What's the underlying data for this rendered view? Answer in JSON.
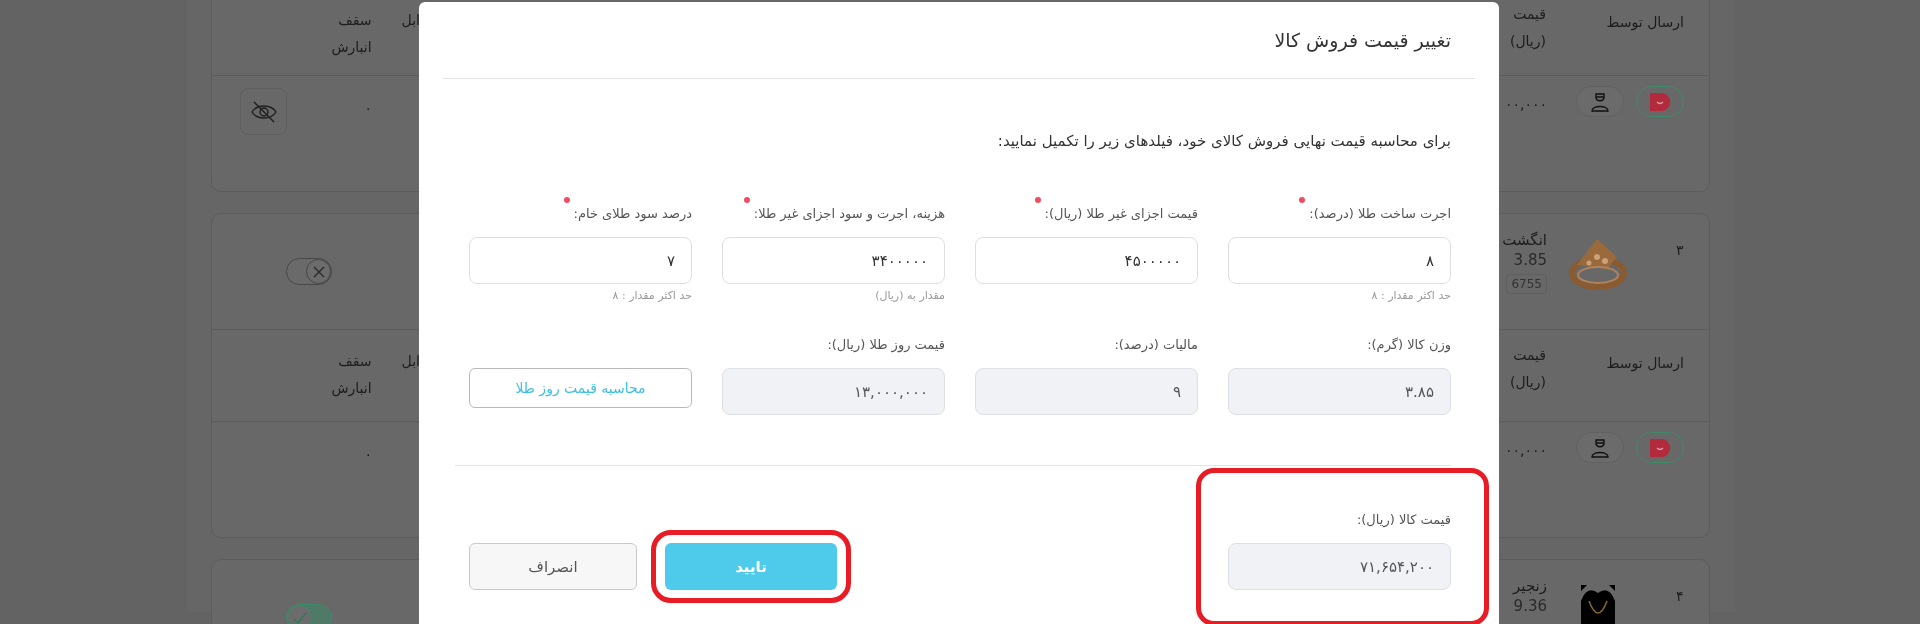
{
  "background": {
    "cards": [
      {
        "sections": [
          {
            "kind": "header",
            "storage_cap": "سقف انبارش",
            "cut_column": "ابل",
            "price_lines": [
              "قیمت",
              "(ریال)"
            ],
            "shipper": "ارسال توسط"
          },
          {
            "kind": "values",
            "eye_button": true,
            "stock_cap": "۰",
            "price": "۰۰,۰۰۰"
          }
        ]
      },
      {
        "sections": [
          {
            "kind": "product",
            "active": false,
            "index": "۳",
            "name": "انگشت",
            "weight": "3.85",
            "code": "6755"
          },
          {
            "kind": "header",
            "storage_cap": "سقف انبارش",
            "cut_column": "ابل",
            "price_lines": [
              "قیمت",
              "(ریال)"
            ],
            "shipper": "ارسال توسط"
          },
          {
            "kind": "values",
            "eye_button": false,
            "stock_cap": "۰",
            "price": "۰۰,۰۰۰"
          }
        ]
      },
      {
        "sections": [
          {
            "kind": "product",
            "active": true,
            "index": "۴",
            "name": "زنجیر",
            "weight": "9.36"
          }
        ]
      }
    ]
  },
  "modal": {
    "title": "تغییر قیمت فروش کالا",
    "intro": "برای محاسبه قیمت نهایی فروش کالای خود، فیلدهای زیر را تکمیل نمایید:",
    "fields": [
      {
        "kind": "input",
        "label": "اجرت ساخت طلا (درصد):",
        "required": true,
        "readonly": false,
        "value": "۸",
        "hint": "حد اکثر مقدار : ۸"
      },
      {
        "kind": "input",
        "label": "قیمت اجزای غیر طلا (ریال):",
        "required": true,
        "readonly": false,
        "value": "۴۵۰۰۰۰۰"
      },
      {
        "kind": "input",
        "label": "هزینه، اجرت و سود اجزای غیر طلا:",
        "required": true,
        "readonly": false,
        "value": "۳۴۰۰۰۰۰",
        "hint": "مقدار به (ریال)"
      },
      {
        "kind": "input",
        "label": "درصد سود طلای خام:",
        "required": true,
        "readonly": false,
        "value": "۷",
        "hint": "حد اکثر مقدار : ۸"
      },
      {
        "kind": "input",
        "label": "وزن کالا (گرم):",
        "readonly": true,
        "value": "۳.۸۵"
      },
      {
        "kind": "input",
        "label": "مالیات (درصد):",
        "readonly": true,
        "value": "۹"
      },
      {
        "kind": "input",
        "label": "قیمت روز طلا (ریال):",
        "readonly": true,
        "value": "۱۳,۰۰۰,۰۰۰"
      },
      {
        "kind": "button",
        "label": "محاسبه قیمت روز طلا"
      }
    ],
    "total": {
      "label": "قیمت کالا (ریال):",
      "value": "۷۱,۶۵۴,۲۰۰",
      "readonly": true,
      "highlighted": true
    },
    "buttons": [
      {
        "kind": "primary",
        "label": "تایید",
        "highlighted": true
      },
      {
        "kind": "secondary",
        "label": "انصراف",
        "highlighted": false
      }
    ]
  }
}
